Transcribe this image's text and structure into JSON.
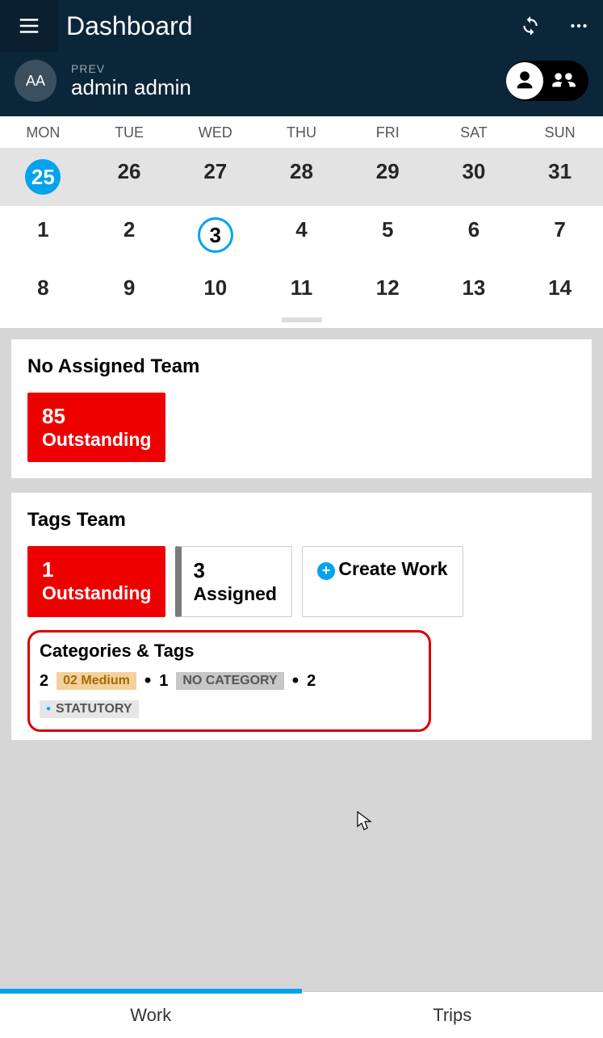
{
  "header": {
    "title": "Dashboard",
    "prev_label": "PREV",
    "user_initials": "AA",
    "user_name": "admin admin"
  },
  "calendar": {
    "day_labels": [
      "MON",
      "TUE",
      "WED",
      "THU",
      "FRI",
      "SAT",
      "SUN"
    ],
    "rows": [
      {
        "prev_month": true,
        "days": [
          "25",
          "26",
          "27",
          "28",
          "29",
          "30",
          "31"
        ],
        "selected_idx": 0
      },
      {
        "prev_month": false,
        "days": [
          "1",
          "2",
          "3",
          "4",
          "5",
          "6",
          "7"
        ],
        "today_idx": 2
      },
      {
        "prev_month": false,
        "days": [
          "8",
          "9",
          "10",
          "11",
          "12",
          "13",
          "14"
        ]
      }
    ]
  },
  "team1": {
    "title": "No Assigned Team",
    "outstanding_count": "85",
    "outstanding_label": "Outstanding"
  },
  "team2": {
    "title": "Tags Team",
    "outstanding_count": "1",
    "outstanding_label": "Outstanding",
    "assigned_count": "3",
    "assigned_label": "Assigned",
    "create_label": "Create Work"
  },
  "cats": {
    "title": "Categories & Tags",
    "items": [
      {
        "count": "2",
        "label": "02 Medium",
        "style": "medium"
      },
      {
        "count": "1",
        "label": "NO CATEGORY",
        "style": "nocat"
      },
      {
        "count": "2",
        "label": "STATUTORY",
        "style": "statutory"
      }
    ]
  },
  "tabs": {
    "work": "Work",
    "trips": "Trips"
  }
}
